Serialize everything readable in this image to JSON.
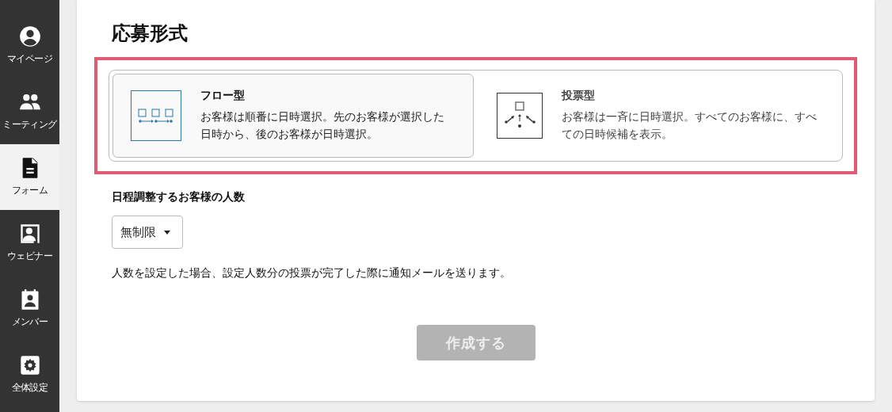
{
  "sidebar": {
    "items": [
      {
        "label": "マイページ",
        "selected": false
      },
      {
        "label": "ミーティング",
        "selected": false
      },
      {
        "label": "フォーム",
        "selected": true
      },
      {
        "label": "ウェビナー",
        "selected": false
      },
      {
        "label": "メンバー",
        "selected": false
      },
      {
        "label": "全体設定",
        "selected": false
      }
    ]
  },
  "section_title": "応募形式",
  "options": [
    {
      "title": "フロー型",
      "description": "お客様は順番に日時選択。先のお客様が選択した日時から、後のお客様が日時選択。",
      "selected": true
    },
    {
      "title": "投票型",
      "description": "お客様は一斉に日時選択。すべてのお客様に、すべての日時候補を表示。",
      "selected": false
    }
  ],
  "count_field": {
    "label": "日程調整するお客様の人数",
    "value": "無制限"
  },
  "note": "人数を設定した場合、設定人数分の投票が完了した際に通知メールを送ります。",
  "submit_button": {
    "label": "作成する",
    "disabled": true
  }
}
